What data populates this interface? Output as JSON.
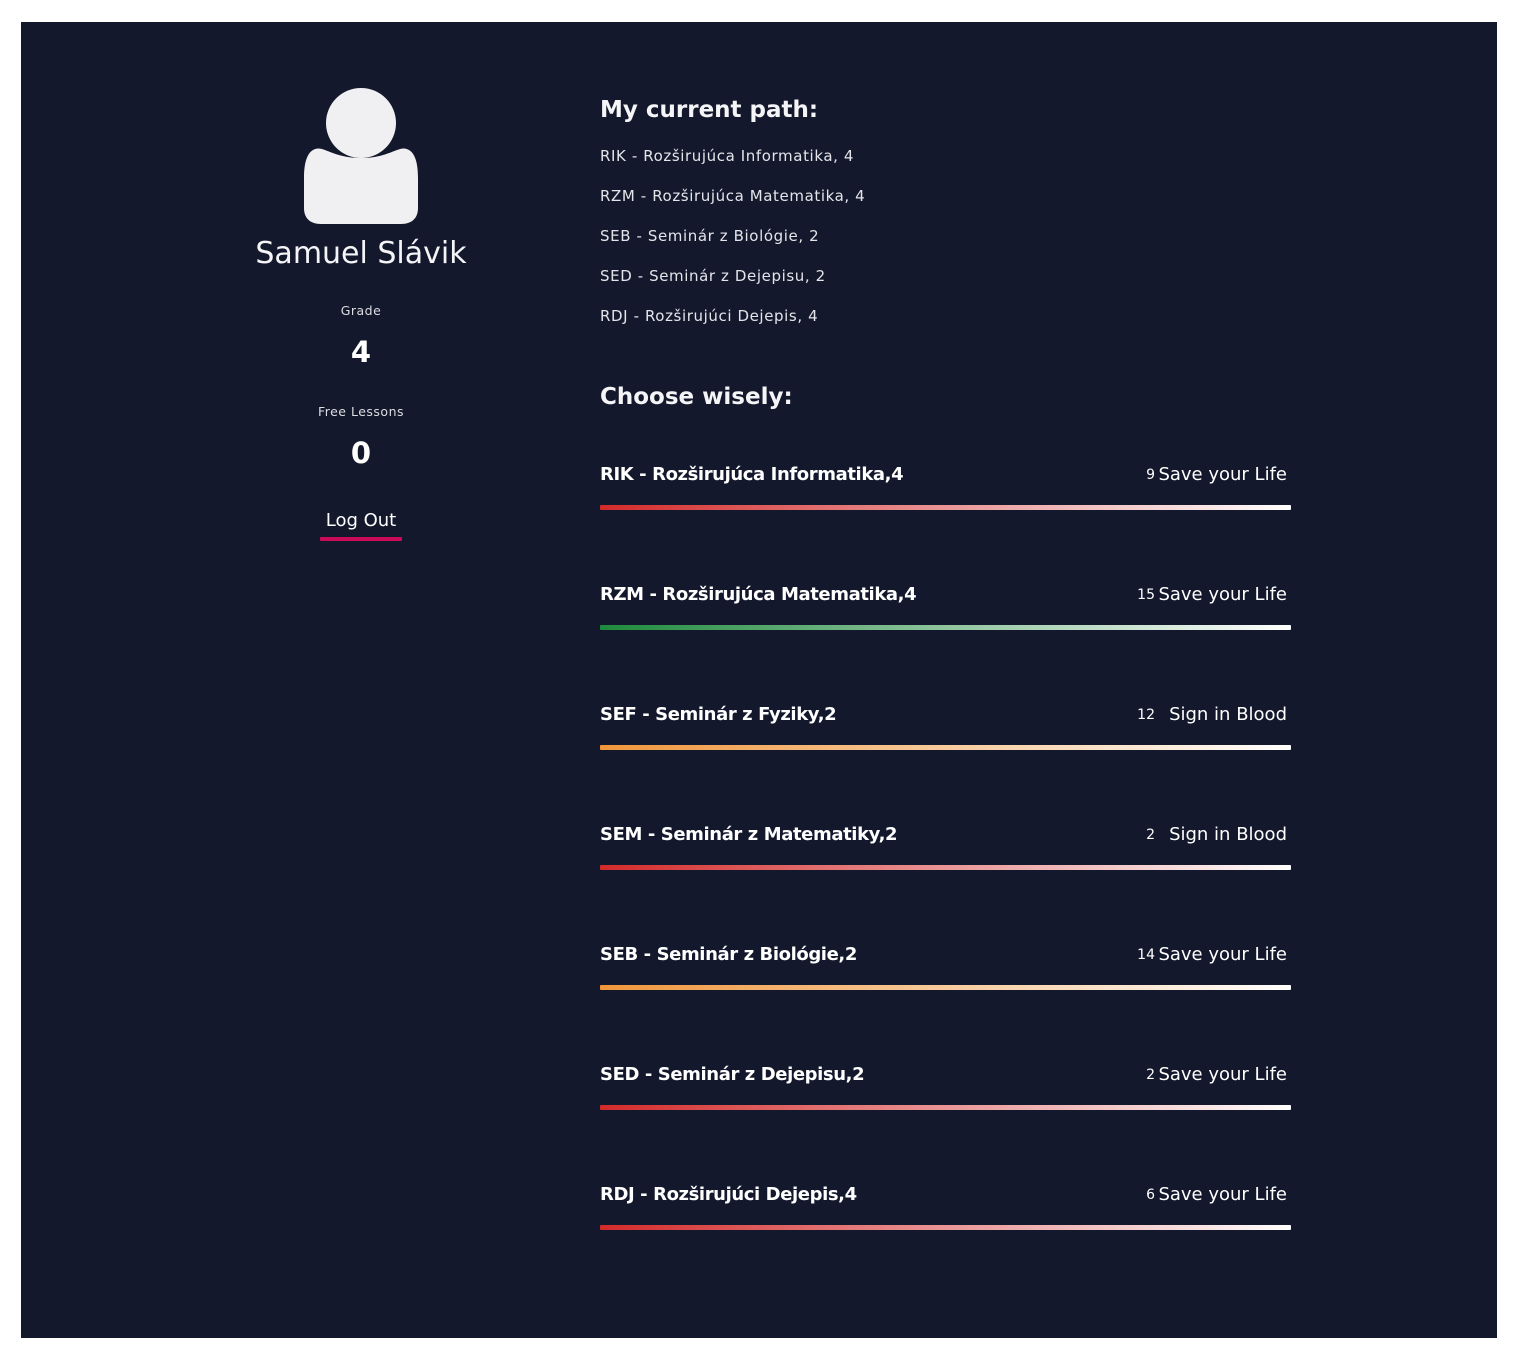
{
  "colors": {
    "background": "#14182c",
    "logout_underline": "#cc0a5a",
    "bar_red": "#d42a2a",
    "bar_green": "#1e8a3c",
    "bar_orange": "#f0963a",
    "bar_end": "#ffffff"
  },
  "profile": {
    "avatar_icon": "user-silhouette-icon",
    "name": "Samuel Slávik",
    "grade_label": "Grade",
    "grade_value": "4",
    "free_lessons_label": "Free Lessons",
    "free_lessons_value": "0",
    "logout_label": "Log Out"
  },
  "current_path": {
    "title": "My current path:",
    "items": [
      "RIK - Rozširujúca Informatika, 4",
      "RZM - Rozširujúca Matematika, 4",
      "SEB - Seminár z Biológie, 2",
      "SED - Seminár z Dejepisu, 2",
      "RDJ - Rozširujúci Dejepis, 4"
    ]
  },
  "choose": {
    "title": "Choose wisely:",
    "courses": [
      {
        "name": "RIK - Rozširujúca Informatika,4",
        "count": "9",
        "action": "Save your Life",
        "bar_color": "red"
      },
      {
        "name": "RZM - Rozširujúca Matematika,4",
        "count": "15",
        "action": "Save your Life",
        "bar_color": "green"
      },
      {
        "name": "SEF - Seminár z Fyziky,2",
        "count": "12",
        "action": "Sign in Blood",
        "bar_color": "orange"
      },
      {
        "name": "SEM - Seminár z Matematiky,2",
        "count": "2",
        "action": "Sign in Blood",
        "bar_color": "red"
      },
      {
        "name": "SEB - Seminár z Biológie,2",
        "count": "14",
        "action": "Save your Life",
        "bar_color": "orange"
      },
      {
        "name": "SED - Seminár z Dejepisu,2",
        "count": "2",
        "action": "Save your Life",
        "bar_color": "red"
      },
      {
        "name": "RDJ - Rozširujúci Dejepis,4",
        "count": "6",
        "action": "Save your Life",
        "bar_color": "red"
      }
    ]
  }
}
